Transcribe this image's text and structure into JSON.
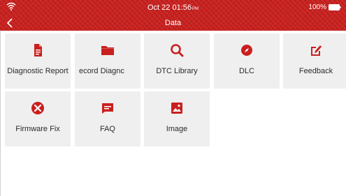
{
  "status_bar": {
    "time": "Oct 22  01:56",
    "ampm": "PM",
    "battery": "100%"
  },
  "header": {
    "title": "Data"
  },
  "tiles": [
    {
      "label": "Diagnostic Report",
      "icon": "document-icon"
    },
    {
      "label": "ecord      Diagnc",
      "icon": "folder-icon"
    },
    {
      "label": "DTC Library",
      "icon": "search-icon"
    },
    {
      "label": "DLC",
      "icon": "compass-icon"
    },
    {
      "label": "Feedback",
      "icon": "edit-icon"
    },
    {
      "label": "Firmware Fix",
      "icon": "tools-icon"
    },
    {
      "label": "FAQ",
      "icon": "chat-icon"
    },
    {
      "label": "Image",
      "icon": "image-icon"
    }
  ],
  "colors": {
    "accent": "#c8201e",
    "tile_bg": "#efefef",
    "text": "#2a2a2a"
  }
}
